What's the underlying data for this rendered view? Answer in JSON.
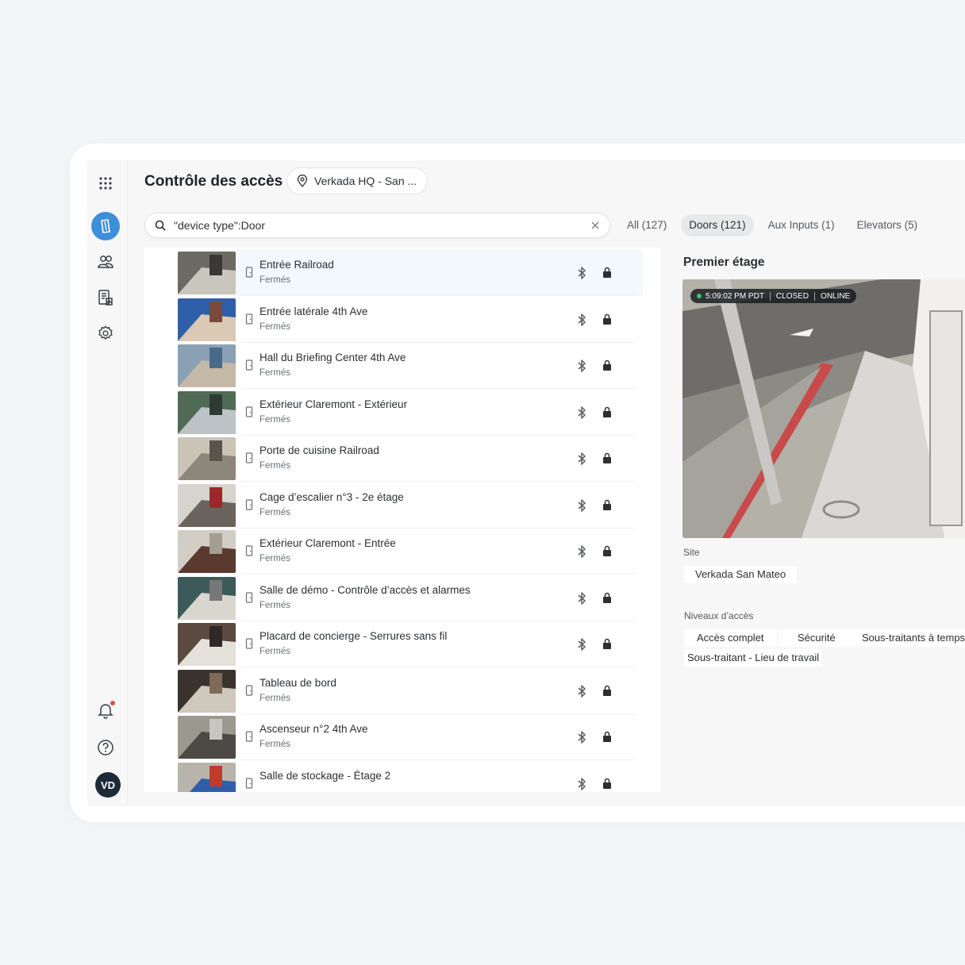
{
  "header": {
    "title": "Contrôle des accès",
    "site_selector": "Verkada HQ - San ..."
  },
  "search": {
    "value": "\"device type\":Door"
  },
  "tabs": [
    {
      "label": "All (127)"
    },
    {
      "label": "Doors (121)"
    },
    {
      "label": "Aux Inputs (1)"
    },
    {
      "label": "Elevators (5)"
    }
  ],
  "doors": [
    {
      "name": "Entrée Railroad",
      "status": "Fermés"
    },
    {
      "name": "Entrée latérale 4th Ave",
      "status": "Fermés"
    },
    {
      "name": "Hall du Briefing Center 4th Ave",
      "status": "Fermés"
    },
    {
      "name": "Extérieur Claremont - Extérieur",
      "status": "Fermés"
    },
    {
      "name": "Porte de cuisine Railroad",
      "status": "Fermés"
    },
    {
      "name": "Cage d’escalier n°3 - 2e étage",
      "status": "Fermés"
    },
    {
      "name": "Extérieur Claremont - Entrée",
      "status": "Fermés"
    },
    {
      "name": "Salle de démo - Contrôle d’accès et alarmes",
      "status": "Fermés"
    },
    {
      "name": "Placard de concierge - Serrures sans fil",
      "status": "Fermés"
    },
    {
      "name": "Tableau de bord",
      "status": "Fermés"
    },
    {
      "name": "Ascenseur n°2 4th Ave",
      "status": "Fermés"
    },
    {
      "name": "Salle de stockage - Étage 2",
      "status": ""
    }
  ],
  "detail": {
    "title": "Premier étage",
    "camera": {
      "time": "5:09:02 PM PDT",
      "door_state": "CLOSED",
      "connection": "ONLINE"
    },
    "site_label": "Site",
    "site_value": "Verkada San Mateo",
    "access_label": "Niveaux d’accès",
    "access_levels": [
      "Accès complet",
      "Sécurité",
      "Sous-traitants à temps",
      "Sous-traitant - Lieu de travail"
    ]
  },
  "user": {
    "initials": "VD"
  },
  "icons": [
    "apps-grid-icon",
    "doors-icon",
    "users-icon",
    "reports-icon",
    "settings-icon",
    "bell-icon",
    "help-icon",
    "location-pin-icon",
    "search-icon",
    "clear-icon",
    "door-icon",
    "bluetooth-icon",
    "lock-icon"
  ],
  "colors": {
    "accent": "#3e8ed8",
    "avatar": "#1d2b38",
    "online": "#3ac46b",
    "alert": "#e24b4b"
  }
}
